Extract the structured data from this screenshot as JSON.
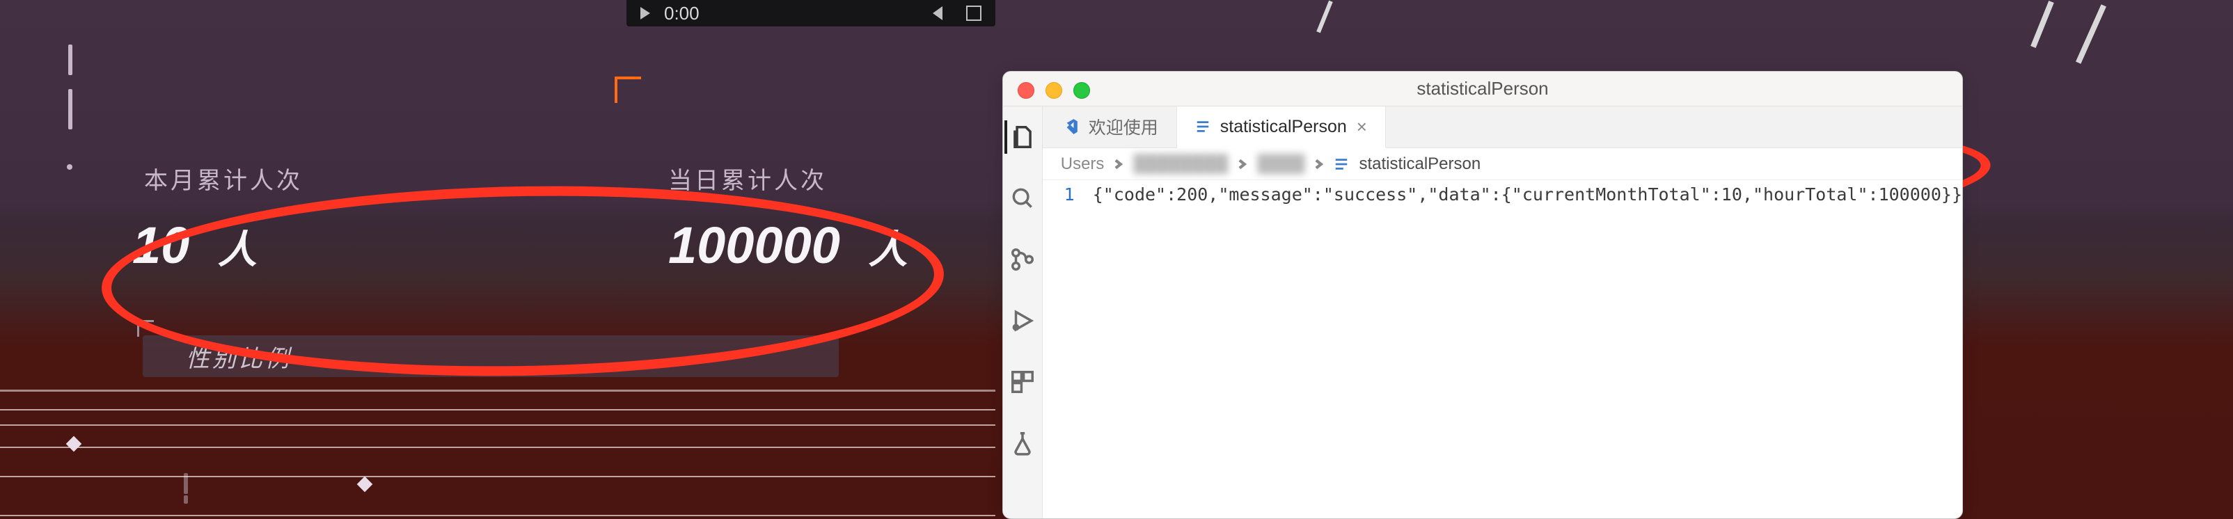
{
  "dashboard": {
    "video": {
      "time": "0:00"
    },
    "metrics": [
      {
        "label": "本月累计人次",
        "value": "10",
        "unit": "人"
      },
      {
        "label": "当日累计人次",
        "value": "100000",
        "unit": "人"
      }
    ],
    "gender_label": "性别比例"
  },
  "vscode": {
    "window_title": "statisticalPerson",
    "tabs": [
      {
        "label": "欢迎使用",
        "active": false,
        "icon": "vscode"
      },
      {
        "label": "statisticalPerson",
        "active": true,
        "icon": "lines"
      }
    ],
    "breadcrumb": {
      "root": "Users",
      "file": "statisticalPerson"
    },
    "lineno": "1",
    "code_line": "{\"code\":200,\"message\":\"success\",\"data\":{\"currentMonthTotal\":10,\"hourTotal\":100000}}"
  }
}
